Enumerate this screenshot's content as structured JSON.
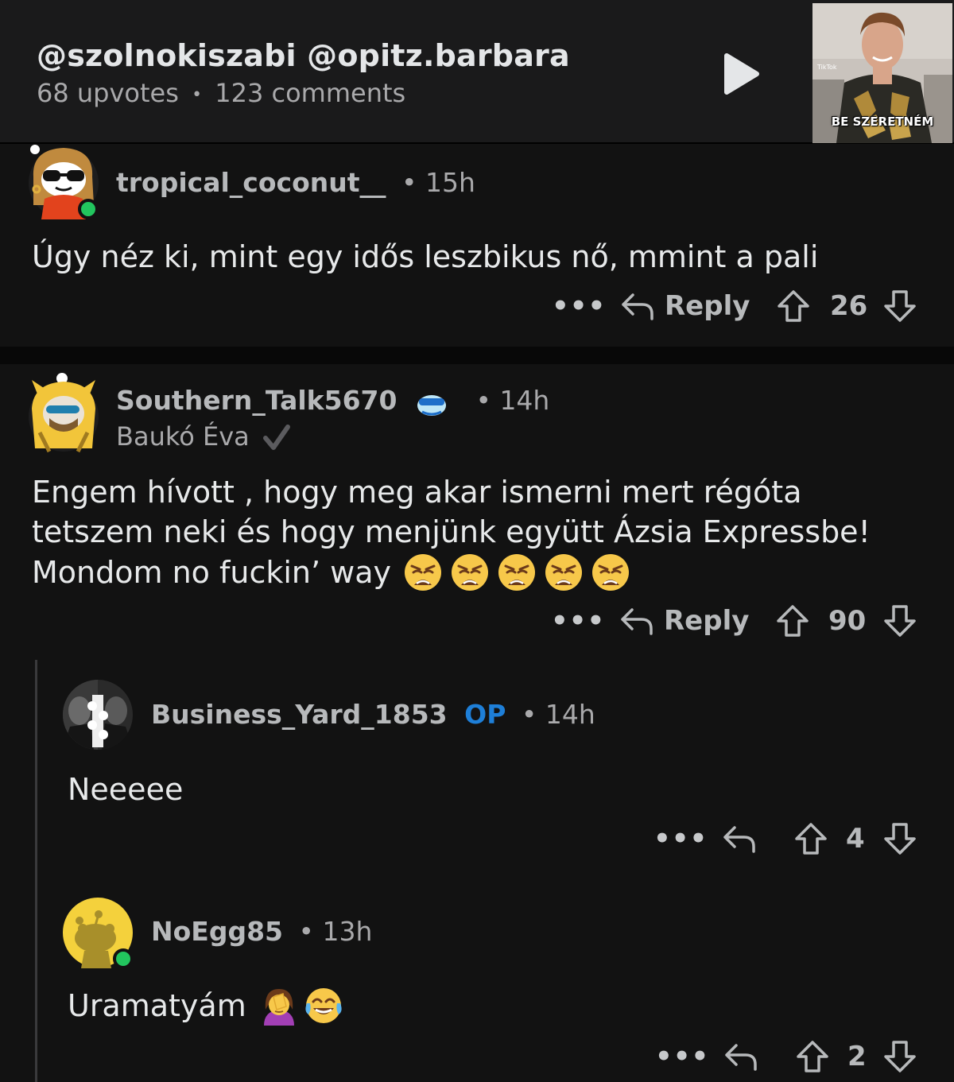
{
  "header": {
    "title": "@szolnokiszabi @opitz.barbara",
    "upvotes": "68 upvotes",
    "separator": "•",
    "comments": "123 comments",
    "thumbnail_caption": "BE SZERETNÉM",
    "thumbnail_brand": "TikTok"
  },
  "comments": [
    {
      "username": "tropical_coconut__",
      "time": "• 15h",
      "body": "Úgy néz ki, mint egy idős leszbikus nő, mmint a pali",
      "more": "•••",
      "reply": "Reply",
      "score": "26"
    },
    {
      "username": "Southern_Talk5670",
      "time": "• 14h",
      "flair": "Baukó Éva",
      "body_lines": [
        "Engem hívott , hogy meg akar ismerni mert régóta",
        "tetszem neki és hogy menjünk együtt Ázsia Expressbe!",
        "Mondom no fuckin’ way"
      ],
      "emoji": "weary-face",
      "emoji_count": 5,
      "more": "•••",
      "reply": "Reply",
      "score": "90"
    },
    {
      "username": "Business_Yard_1853",
      "op_badge": "OP",
      "time": "• 14h",
      "body": "Neeeee",
      "more": "•••",
      "score": "4"
    },
    {
      "username": "NoEgg85",
      "time": "• 13h",
      "body": "Uramatyám",
      "emojis": [
        "woman-facepalming",
        "face-with-tears-of-joy"
      ],
      "more": "•••",
      "score": "2"
    }
  ],
  "colors": {
    "background": "#121212",
    "header_bg": "#1a1a1b",
    "op_blue": "#1e7fd8",
    "online_green": "#22c55e",
    "text_primary": "#e7e9ea",
    "text_muted": "#a9a9ab"
  }
}
